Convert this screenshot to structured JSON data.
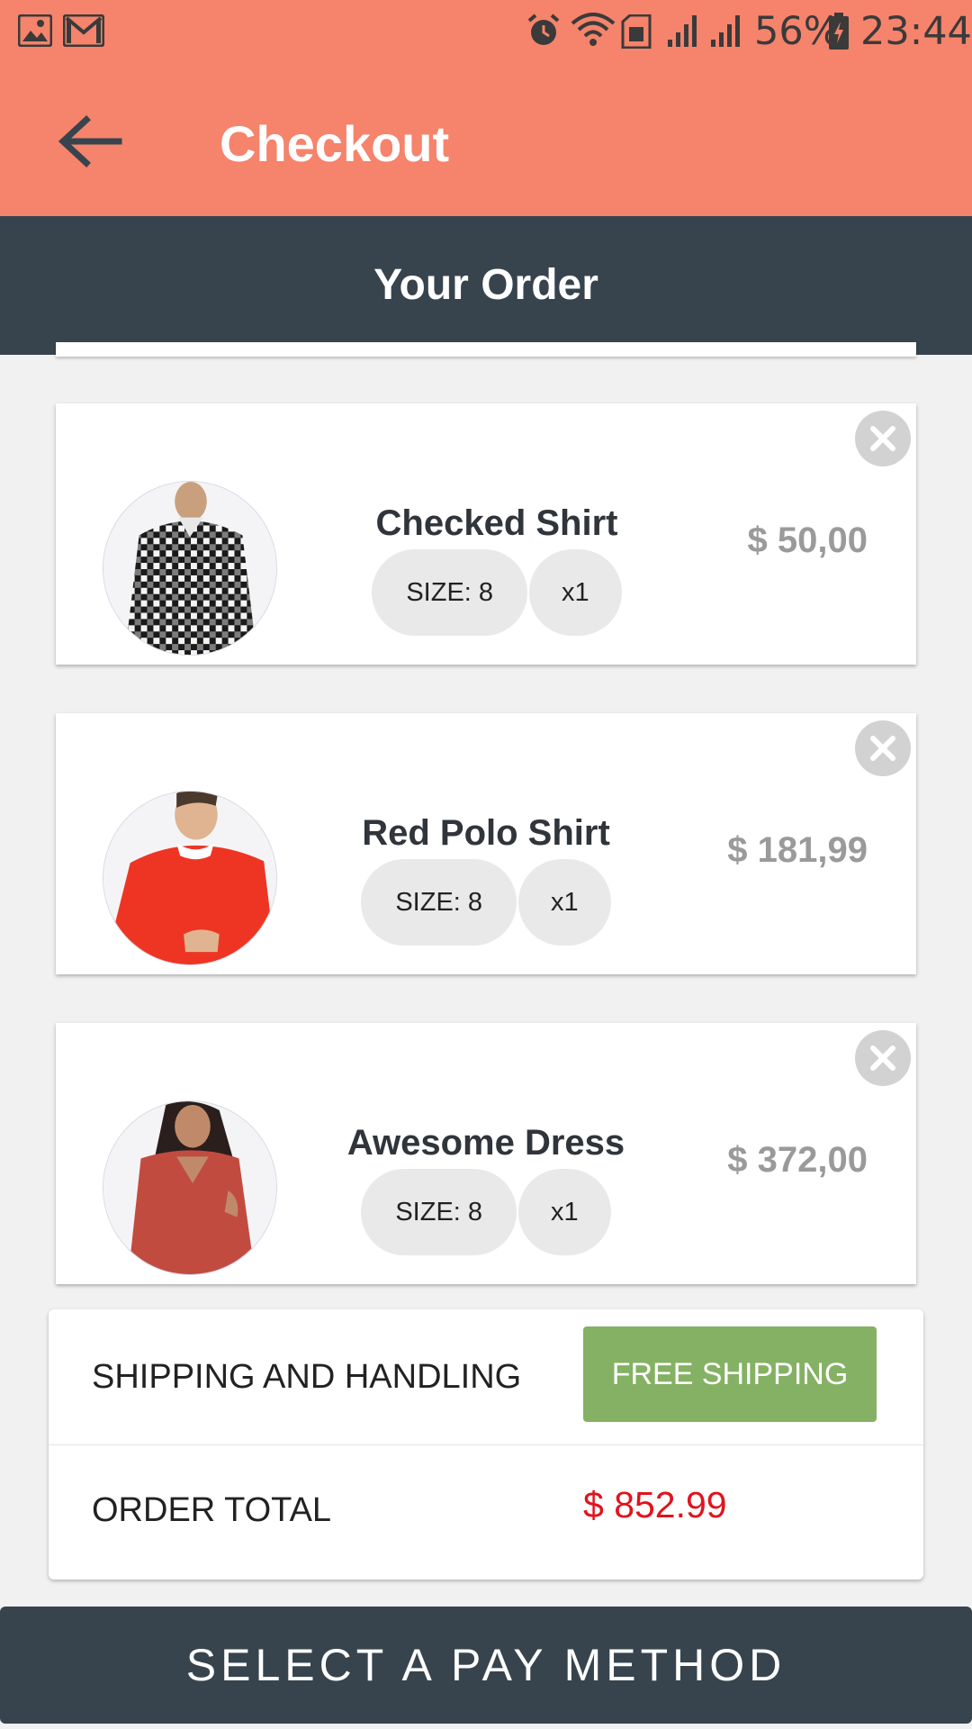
{
  "status_bar": {
    "battery": "56%",
    "time": "23:44",
    "icons": [
      "gallery-icon",
      "gmail-icon",
      "alarm-icon",
      "wifi-icon",
      "sim-icon",
      "signal-icon",
      "signal-icon",
      "battery-charging-icon"
    ]
  },
  "app_bar": {
    "title": "Checkout",
    "back_icon": "arrow-left-icon"
  },
  "section": {
    "title": "Your Order"
  },
  "items": [
    {
      "name": "Checked Shirt",
      "size": "SIZE: 8",
      "qty": "x1",
      "price": "$ 50,00",
      "image": "checked-shirt-photo"
    },
    {
      "name": "Red Polo Shirt",
      "size": "SIZE: 8",
      "qty": "x1",
      "price": "$ 181,99",
      "image": "red-polo-shirt-photo"
    },
    {
      "name": "Awesome Dress",
      "size": "SIZE: 8",
      "qty": "x1",
      "price": "$ 372,00",
      "image": "awesome-dress-photo"
    }
  ],
  "summary": {
    "shipping_label": "SHIPPING AND HANDLING",
    "shipping_value": "FREE SHIPPING",
    "total_label": "ORDER TOTAL",
    "total_value": "$ 852.99"
  },
  "pay_button": {
    "label": "SELECT A PAY METHOD"
  },
  "colors": {
    "primary": "#f6836b",
    "dark": "#37444d",
    "shipping_green": "#84b163",
    "total_red": "#e0141e",
    "price_gray": "#9a9a9a"
  }
}
